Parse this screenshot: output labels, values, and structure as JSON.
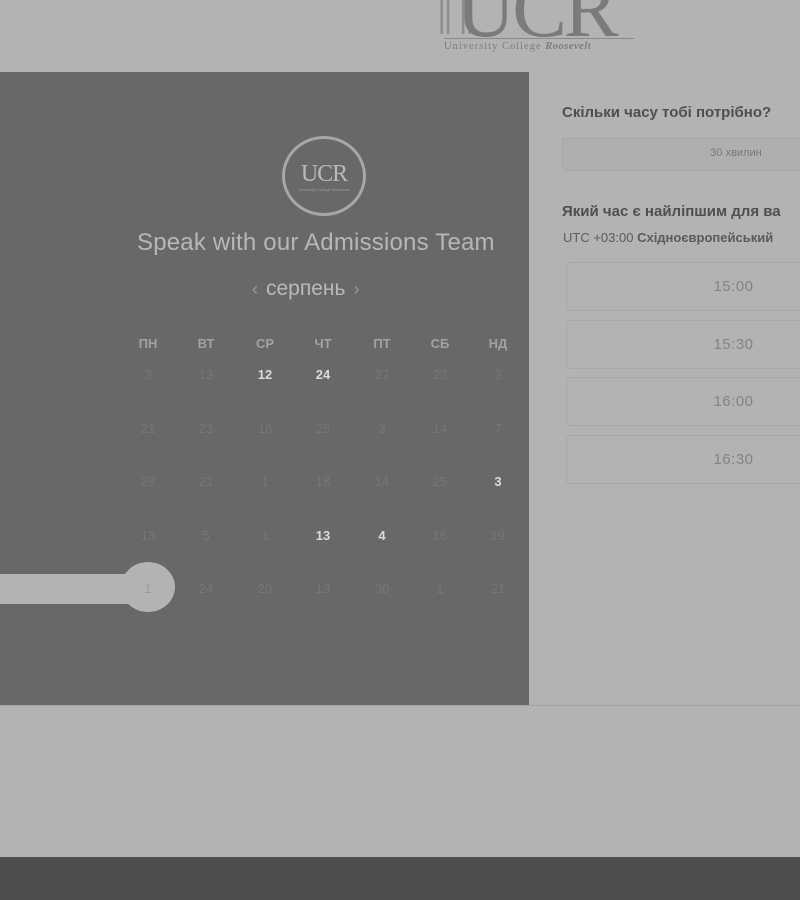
{
  "header": {
    "logo_mark": "UCR",
    "logo_sub": "University College",
    "logo_sub2": "Roosevelt"
  },
  "calendar": {
    "badge_text": "UCR",
    "badge_sub": "University College Roosevelt",
    "title": "Speak with our Admissions Team",
    "month": "серпень",
    "prev": "‹",
    "next": "›",
    "weekdays": [
      "ПН",
      "ВТ",
      "СР",
      "ЧТ",
      "ПТ",
      "СБ",
      "НД"
    ],
    "weeks": [
      [
        "3",
        "13",
        "12",
        "24",
        "27",
        "23",
        "3"
      ],
      [
        "21",
        "23",
        "16",
        "25",
        "3",
        "14",
        "7"
      ],
      [
        "28",
        "21",
        "1",
        "18",
        "14",
        "25",
        "3"
      ],
      [
        "13",
        "5",
        "1",
        "13",
        "4",
        "16",
        "19"
      ],
      [
        "1",
        "24",
        "20",
        "13",
        "30",
        "1",
        "21"
      ]
    ],
    "available": [
      [
        0,
        2
      ],
      [
        0,
        3
      ],
      [
        2,
        6
      ],
      [
        3,
        3
      ],
      [
        3,
        4
      ]
    ],
    "selected": [
      4,
      0
    ]
  },
  "scheduler": {
    "duration_question": "Скільки часу тобі потрібно?",
    "duration_value": "30 хвилин",
    "time_question": "Який час є найліпшим для ва",
    "tz_offset": "UTC +03:00",
    "tz_name": "Східноєвропейський",
    "slots": [
      "15:00",
      "15:30",
      "16:00",
      "16:30"
    ]
  }
}
